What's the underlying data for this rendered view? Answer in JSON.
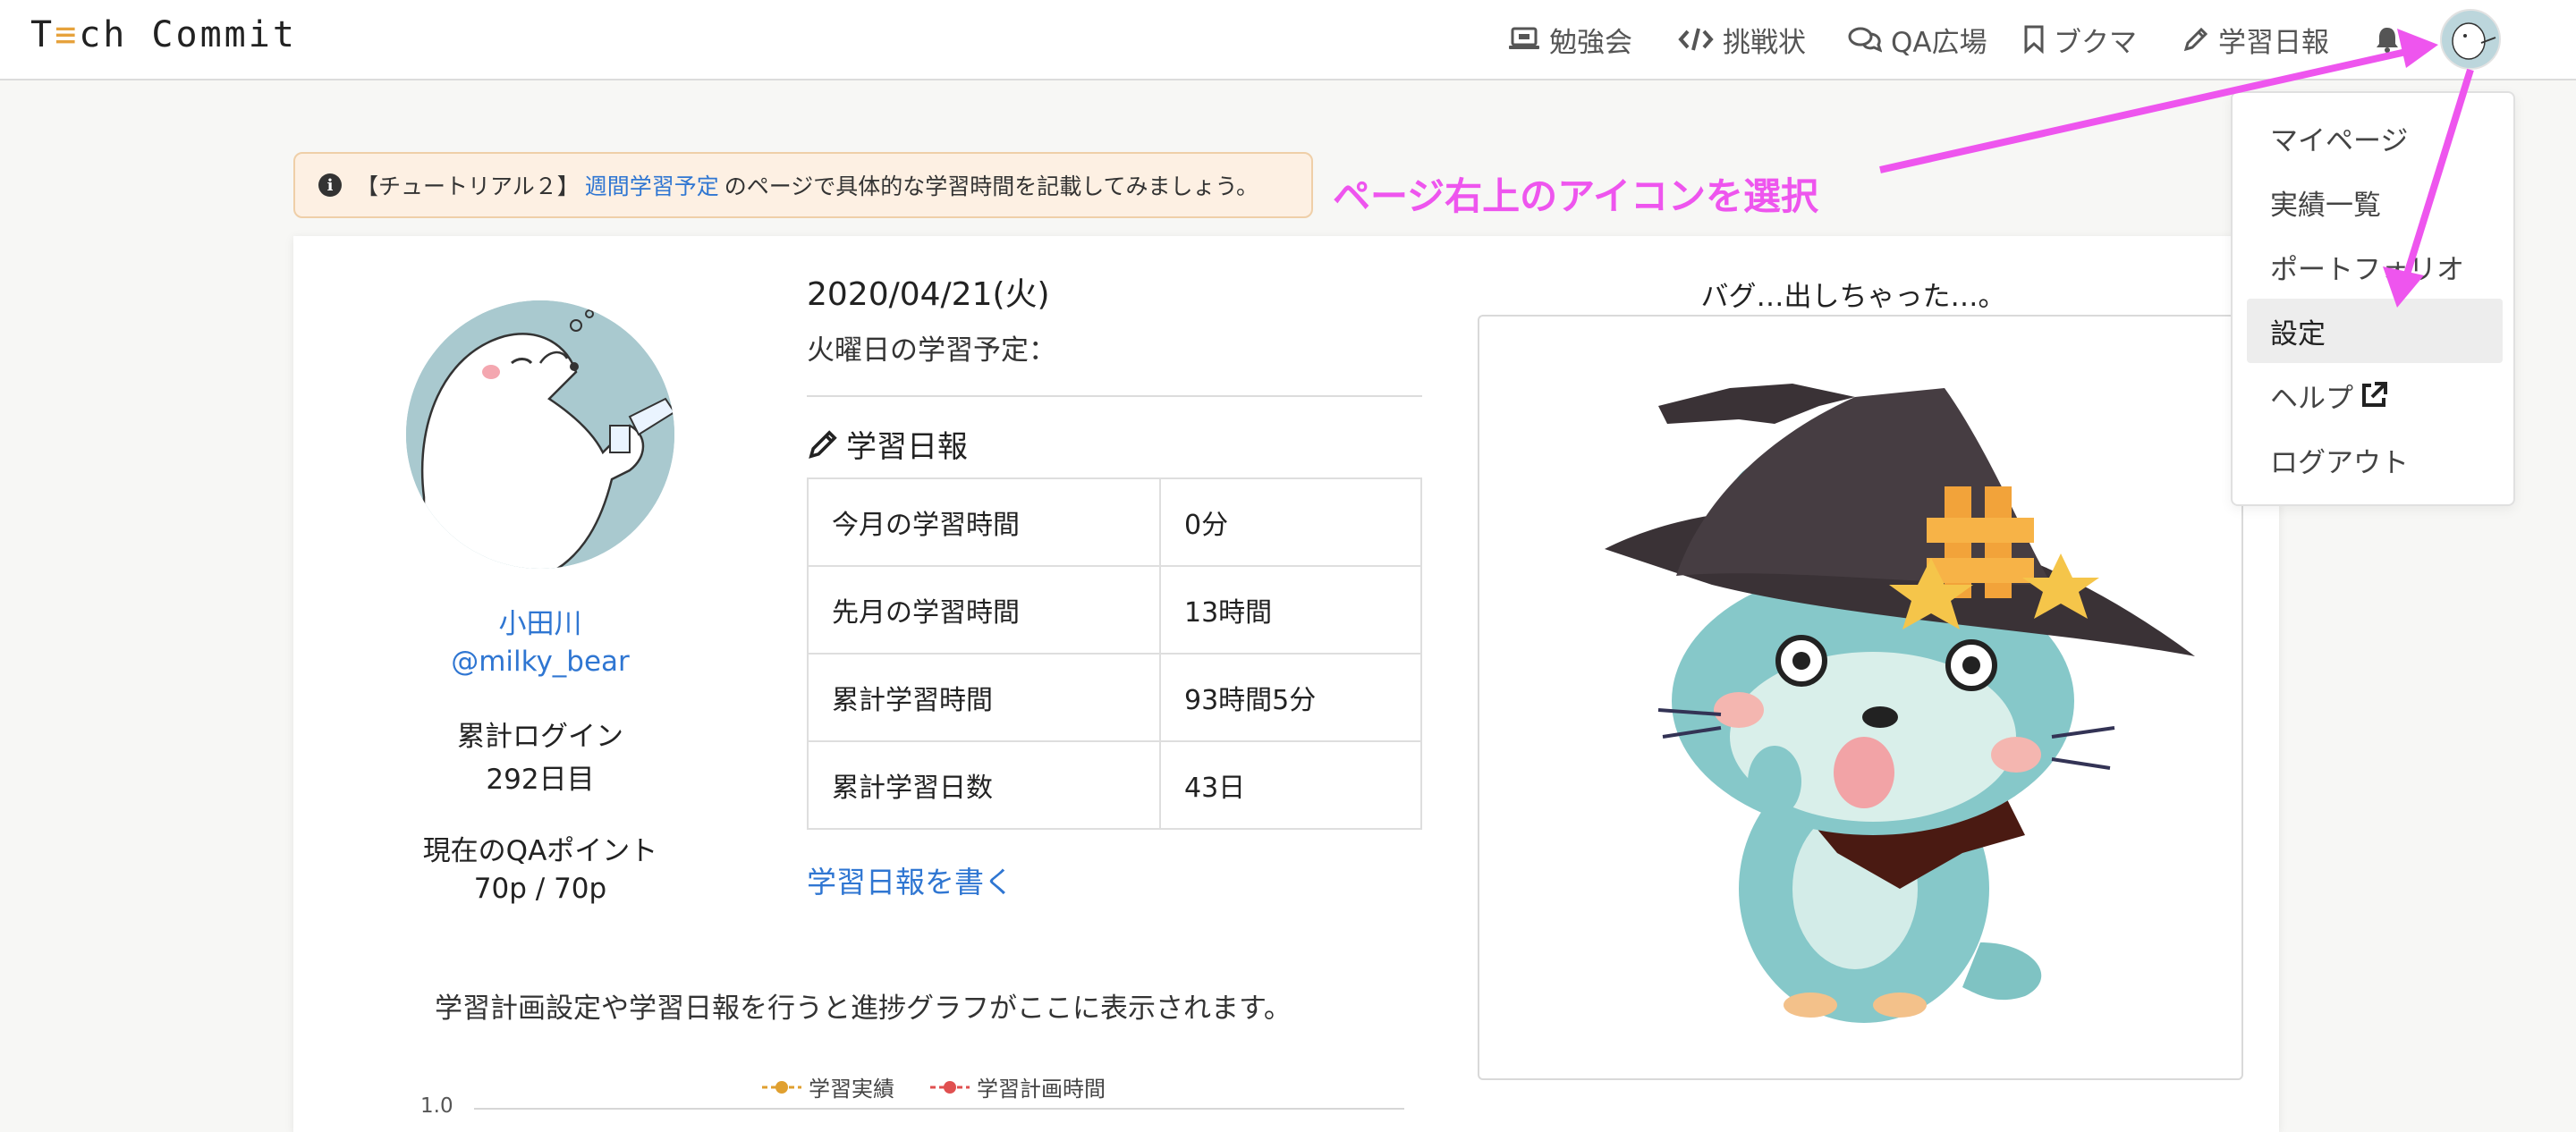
{
  "header": {
    "logo": {
      "prefix": "T",
      "mark": "≡",
      "suffix": "ch Commit"
    },
    "nav": [
      {
        "label": "勉強会",
        "icon": "laptop-icon"
      },
      {
        "label": "挑戦状",
        "icon": "code-icon"
      },
      {
        "label": "QA広場",
        "icon": "chat-bubbles-icon"
      },
      {
        "label": "ブクマ",
        "icon": "bookmark-icon"
      },
      {
        "label": "学習日報",
        "icon": "pencil-icon"
      }
    ],
    "notification_icon": "bell-icon",
    "avatar_icon": "user-avatar"
  },
  "alert": {
    "prefix": "【チュートリアル２】",
    "link": "週間学習予定",
    "suffix": "のページで具体的な学習時間を記載してみましょう。"
  },
  "profile": {
    "name": "小田川",
    "handle": "@milky_bear",
    "login_label": "累計ログイン",
    "login_value": "292日目",
    "qa_label": "現在のQAポイント",
    "qa_value": "70p / 70p"
  },
  "report": {
    "date": "2020/04/21(火)",
    "schedule_label": "火曜日の学習予定：",
    "heading": "学習日報",
    "rows": [
      {
        "label": "今月の学習時間",
        "value": "0分"
      },
      {
        "label": "先月の学習時間",
        "value": "13時間"
      },
      {
        "label": "累計学習時間",
        "value": "93時間5分"
      },
      {
        "label": "累計学習日数",
        "value": "43日"
      }
    ],
    "write_link": "学習日報を書く"
  },
  "chart": {
    "message": "学習計画設定や学習日報を行うと進捗グラフがここに表示されます。",
    "legend": [
      {
        "name": "学習実績",
        "color": "#e0a030"
      },
      {
        "name": "学習計画時間",
        "color": "#e05050"
      }
    ],
    "y_tick": "1.0"
  },
  "illustration": {
    "caption": "バグ…出しちゃった…。"
  },
  "dropdown": {
    "items": [
      {
        "label": "マイページ",
        "active": false
      },
      {
        "label": "実績一覧",
        "active": false
      },
      {
        "label": "ポートフォリオ",
        "active": false
      },
      {
        "label": "設定",
        "active": true
      },
      {
        "label": "ヘルプ",
        "active": false,
        "external": true
      },
      {
        "label": "ログアウト",
        "active": false
      }
    ]
  },
  "annotation": {
    "text": "ページ右上のアイコンを選択",
    "color": "#ee55ee"
  }
}
